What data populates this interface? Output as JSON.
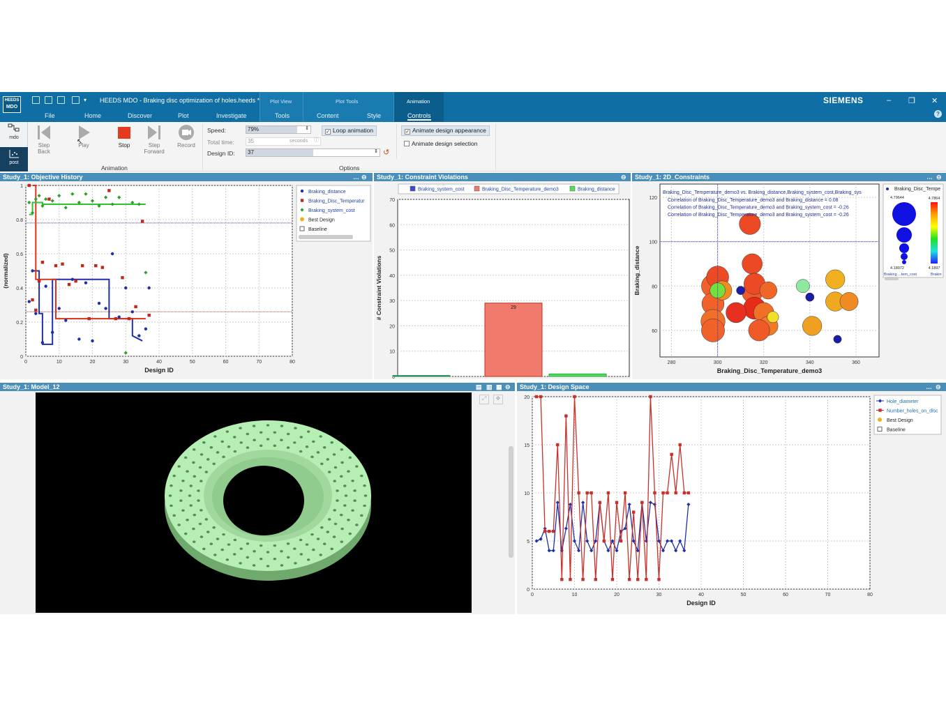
{
  "app": {
    "logo_top": "HEEDS",
    "logo_bottom": "MDO",
    "title": "HEEDS MDO - Braking disc optimization of holes.heeds *",
    "brand": "SIEMENS"
  },
  "menu": [
    "File",
    "Home",
    "Discover",
    "Plot",
    "Investigate"
  ],
  "context_groups": [
    {
      "header": "Plot View",
      "tab": "Tools"
    },
    {
      "header": "Plot Tools",
      "tab_a": "Content",
      "tab_b": "Style"
    },
    {
      "header": "Animation",
      "tab": "Controls"
    }
  ],
  "leftrail": {
    "mdo": "mdo",
    "post": "post"
  },
  "animation": {
    "group": "Animation",
    "buttons": [
      "Step Back",
      "Play",
      "Stop",
      "Step Forward",
      "Record"
    ],
    "active_color": "#e53a20"
  },
  "options": {
    "group": "Options",
    "speed_label": "Speed:",
    "speed_value": "79%",
    "speed_fill": 0.79,
    "total_label": "Total time:",
    "total_value": "35",
    "total_unit": "seconds",
    "design_label": "Design ID:",
    "design_value": "37",
    "loop": "Loop animation",
    "appearance": "Animate design appearance",
    "selection": "Animate design selection"
  },
  "panels": {
    "p1": "Study_1: Objective History",
    "p2": "Study_1: Constraint Violations",
    "p3": "Study_1: 2D_Constraints",
    "p4": "Study_1: Model_12",
    "p5": "Study_1: Design Space"
  },
  "p1_legend": [
    "Braking_distance",
    "Braking_Disc_Temperatur",
    "Braking_system_cost",
    "Best Design",
    "Baseline"
  ],
  "p2_legend": [
    "Braking_system_cost",
    "Braking_Disc_Temperature_demo3",
    "Braking_distance"
  ],
  "p3_header": "Braking_Disc_Temperature_demo3 vs. Braking_distance,Braking_system_cost,Braking_sys",
  "p3_corr": [
    "Correlation of Braking_Disc_Temperature_demo3 and Braking_distance = 0.08",
    "Correlation of Braking_Disc_Temperature_demo3 and Braking_system_cost = -0.26",
    "Correlation of Braking_Disc_Temperature_demo3 and Braking_system_cost = -0.26"
  ],
  "p3_legend": {
    "title": "Braking_Disc_Tempe",
    "size_max": "4.79644",
    "size_min": "4.18972",
    "color_max": "4.7864",
    "color_min": "4.1897",
    "foot_a": "Braking ...tem_cost",
    "foot_b": "Brakin"
  },
  "p5_legend": [
    "Hole_diameter",
    "Number_holes_on_disc",
    "Best Design",
    "Baseline"
  ],
  "chart_data": [
    {
      "type": "scatter",
      "title": "Study_1: Objective History",
      "xlabel": "Design ID",
      "ylabel": "(normalized)",
      "xlim": [
        0,
        80
      ],
      "ylim": [
        0,
        1
      ],
      "xticks": [
        0,
        10,
        20,
        30,
        40,
        50,
        60,
        70,
        80
      ],
      "yticks": [
        0,
        0.2,
        0.4,
        0.6,
        0.8,
        1
      ],
      "series": [
        {
          "name": "Braking_distance",
          "color": "#1f2fa8",
          "x": [
            1,
            2,
            3,
            4,
            5,
            6,
            8,
            10,
            12,
            14,
            16,
            18,
            20,
            22,
            24,
            26,
            28,
            30,
            32,
            34,
            36,
            37
          ],
          "y": [
            0.32,
            0.5,
            0.25,
            0.44,
            0.08,
            0.41,
            0.14,
            0.28,
            0.21,
            0.45,
            0.1,
            0.43,
            0.09,
            0.31,
            0.28,
            0.6,
            0.23,
            0.4,
            0.26,
            0.12,
            0.16,
            0.4
          ]
        },
        {
          "name": "Braking_Disc_Temperatur",
          "color": "#c0281c",
          "x": [
            1,
            2,
            3,
            4,
            5,
            7,
            9,
            11,
            13,
            15,
            17,
            19,
            21,
            23,
            25,
            27,
            29,
            31,
            33,
            35,
            37
          ],
          "y": [
            1.0,
            0.33,
            0.27,
            0.44,
            0.55,
            0.92,
            0.53,
            0.54,
            0.42,
            0.44,
            0.53,
            0.22,
            0.53,
            0.52,
            0.97,
            0.22,
            0.46,
            0.22,
            0.29,
            0.79,
            0.24
          ]
        },
        {
          "name": "Braking_system_cost",
          "color": "#2aa02a",
          "x": [
            1,
            2,
            3,
            4,
            5,
            6,
            8,
            10,
            12,
            14,
            16,
            18,
            20,
            22,
            24,
            26,
            28,
            30,
            32,
            34,
            36
          ],
          "y": [
            0.9,
            0.84,
            0.92,
            0.94,
            0.88,
            0.92,
            0.91,
            0.94,
            0.87,
            0.95,
            0.9,
            0.95,
            0.91,
            0.88,
            0.93,
            0.89,
            0.93,
            0.02,
            0.9,
            0.89,
            0.49
          ]
        }
      ],
      "best_lines": {
        "Braking_distance_x": [
          2,
          4,
          4,
          5,
          5,
          8,
          8,
          25,
          25,
          32,
          32,
          35
        ],
        "Braking_distance_y": [
          0.5,
          0.5,
          0.25,
          0.25,
          0.07,
          0.07,
          0.45,
          0.45,
          0.22,
          0.22,
          0.12,
          0.09
        ],
        "Temperature_x": [
          2,
          3,
          3,
          9,
          9,
          36
        ],
        "Temperature_y": [
          1.0,
          1.0,
          0.45,
          0.45,
          0.22,
          0.22
        ],
        "Cost_x": [
          1,
          2,
          2,
          5,
          5,
          36
        ],
        "Cost_y": [
          0.83,
          0.83,
          0.9,
          0.9,
          0.89,
          0.89
        ]
      },
      "ref_lines": {
        "blue": 0.78,
        "red": 0.26
      }
    },
    {
      "type": "bar",
      "title": "Study_1: Constraint Violations",
      "ylabel": "# Constraint Violations",
      "ylim": [
        0,
        70
      ],
      "yticks": [
        0,
        10,
        20,
        30,
        40,
        50,
        60,
        70
      ],
      "categories": [
        "Braking_system_cost",
        "Braking_Disc_Temperature_demo3",
        "Braking_distance"
      ],
      "values": [
        0,
        29,
        1
      ],
      "colors": [
        "#3b4bd0",
        "#f07a6c",
        "#4fe05b"
      ]
    },
    {
      "type": "scatter",
      "title": "Study_1: 2D_Constraints",
      "xlabel": "Braking_Disc_Temperature_demo3",
      "ylabel": "Braking_distance",
      "xlim": [
        275,
        370
      ],
      "ylim": [
        48,
        126
      ],
      "xticks": [
        280,
        300,
        320,
        340,
        360
      ],
      "yticks": [
        60,
        80,
        100,
        120
      ],
      "crosshair": {
        "x": 300,
        "y": 100
      },
      "points": [
        {
          "x": 298,
          "y": 80,
          "s": 0.9,
          "c": "#f0622a"
        },
        {
          "x": 298,
          "y": 72,
          "s": 0.85,
          "c": "#f0622a"
        },
        {
          "x": 298,
          "y": 64,
          "s": 0.95,
          "c": "#f07028"
        },
        {
          "x": 298,
          "y": 60,
          "s": 0.9,
          "c": "#f0622a"
        },
        {
          "x": 300,
          "y": 84,
          "s": 0.85,
          "c": "#ec4a24"
        },
        {
          "x": 302,
          "y": 78,
          "s": 0.7,
          "c": "#f08a22"
        },
        {
          "x": 300,
          "y": 78,
          "s": 0.5,
          "c": "#74e040"
        },
        {
          "x": 314,
          "y": 108,
          "s": 0.8,
          "c": "#ec4a24"
        },
        {
          "x": 315,
          "y": 77,
          "s": 0.75,
          "c": "#ef5a28"
        },
        {
          "x": 316,
          "y": 70,
          "s": 0.85,
          "c": "#e82a18"
        },
        {
          "x": 320,
          "y": 68,
          "s": 0.75,
          "c": "#f07028"
        },
        {
          "x": 322,
          "y": 62,
          "s": 0.7,
          "c": "#f07a28"
        },
        {
          "x": 318,
          "y": 60,
          "s": 0.8,
          "c": "#ef5a28"
        },
        {
          "x": 315,
          "y": 90,
          "s": 0.75,
          "c": "#ec4a24"
        },
        {
          "x": 316,
          "y": 81,
          "s": 0.8,
          "c": "#ec4a24"
        },
        {
          "x": 308,
          "y": 68,
          "s": 0.75,
          "c": "#e83020"
        },
        {
          "x": 322,
          "y": 78,
          "s": 0.6,
          "c": "#f06528"
        },
        {
          "x": 310,
          "y": 78,
          "s": 0.15,
          "c": "#1c1ca8"
        },
        {
          "x": 337,
          "y": 80,
          "s": 0.4,
          "c": "#8ee8a0"
        },
        {
          "x": 340,
          "y": 75,
          "s": 0.15,
          "c": "#1c1ca8"
        },
        {
          "x": 351,
          "y": 83,
          "s": 0.7,
          "c": "#f0b020"
        },
        {
          "x": 351,
          "y": 73,
          "s": 0.7,
          "c": "#f0a820"
        },
        {
          "x": 357,
          "y": 73,
          "s": 0.65,
          "c": "#f08a22"
        },
        {
          "x": 341,
          "y": 62,
          "s": 0.7,
          "c": "#f0a020"
        },
        {
          "x": 352,
          "y": 56,
          "s": 0.12,
          "c": "#1c1ca8"
        },
        {
          "x": 324,
          "y": 66,
          "s": 0.3,
          "c": "#f0e028"
        }
      ]
    },
    {
      "type": "line",
      "title": "Study_1: Design Space",
      "xlabel": "Design ID",
      "xlim": [
        0,
        80
      ],
      "ylim": [
        0,
        20
      ],
      "xticks": [
        0,
        10,
        20,
        30,
        40,
        50,
        60,
        70,
        80
      ],
      "yticks": [
        0,
        5,
        10,
        15,
        20
      ],
      "x": [
        1,
        2,
        3,
        4,
        5,
        6,
        7,
        8,
        9,
        10,
        11,
        12,
        13,
        14,
        15,
        16,
        17,
        18,
        19,
        20,
        21,
        22,
        23,
        24,
        25,
        26,
        27,
        28,
        29,
        30,
        31,
        32,
        33,
        34,
        35,
        36,
        37
      ],
      "series": [
        {
          "name": "Hole_diameter",
          "color": "#1f2fa8",
          "values": [
            5,
            5.2,
            6.3,
            4,
            4,
            9,
            4,
            6.3,
            8.8,
            5,
            4,
            9,
            5,
            4,
            5,
            9,
            5,
            4,
            5,
            4,
            6,
            6.3,
            8.8,
            5,
            4,
            9,
            5,
            9,
            8.8,
            5,
            4,
            5,
            5,
            4,
            5,
            4,
            8.8
          ]
        },
        {
          "name": "Number_holes_on_disc",
          "color": "#c8302a",
          "values": [
            20,
            20,
            6,
            6,
            6,
            15,
            1,
            18,
            1,
            20,
            10,
            1,
            10,
            10,
            1,
            9,
            5,
            10,
            1,
            9,
            5,
            10,
            1,
            8,
            1,
            9,
            1,
            20,
            10,
            1,
            10,
            10,
            14,
            10,
            15,
            10,
            10
          ]
        }
      ]
    }
  ]
}
